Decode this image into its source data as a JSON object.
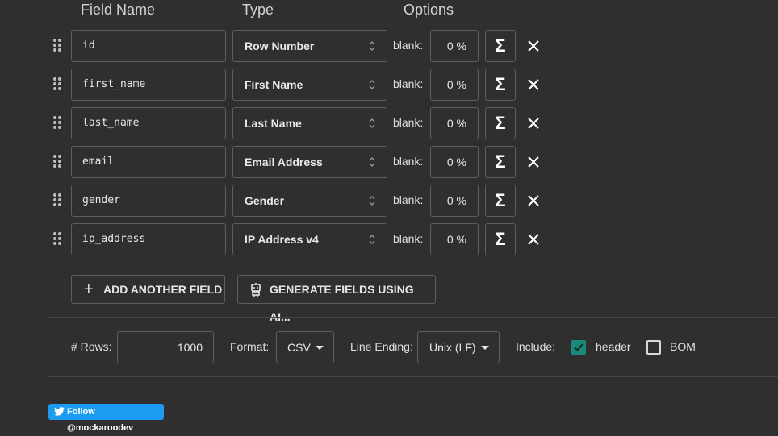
{
  "headers": {
    "field_name": "Field Name",
    "type": "Type",
    "options": "Options"
  },
  "fields": [
    {
      "name": "id",
      "type": "Row Number",
      "blank_label": "blank:",
      "blank_pct": "0 %",
      "sigma": "Σ"
    },
    {
      "name": "first_name",
      "type": "First Name",
      "blank_label": "blank:",
      "blank_pct": "0 %",
      "sigma": "Σ"
    },
    {
      "name": "last_name",
      "type": "Last Name",
      "blank_label": "blank:",
      "blank_pct": "0 %",
      "sigma": "Σ"
    },
    {
      "name": "email",
      "type": "Email Address",
      "blank_label": "blank:",
      "blank_pct": "0 %",
      "sigma": "Σ"
    },
    {
      "name": "gender",
      "type": "Gender",
      "blank_label": "blank:",
      "blank_pct": "0 %",
      "sigma": "Σ"
    },
    {
      "name": "ip_address",
      "type": "IP Address v4",
      "blank_label": "blank:",
      "blank_pct": "0 %",
      "sigma": "Σ"
    }
  ],
  "buttons": {
    "add_field": "ADD ANOTHER FIELD",
    "generate_ai": "GENERATE FIELDS USING AI..."
  },
  "settings": {
    "rows_label": "# Rows:",
    "rows_value": "1000",
    "format_label": "Format:",
    "format_value": "CSV",
    "line_ending_label": "Line Ending:",
    "line_ending_value": "Unix (LF)",
    "include_label": "Include:",
    "header_label": "header",
    "header_checked": true,
    "bom_label": "BOM",
    "bom_checked": false
  },
  "twitter": {
    "label": "Follow @mockaroodev"
  },
  "colors": {
    "background": "#2f2f2f",
    "border": "#5e5e5e",
    "checkbox_accent": "#1a8a7a",
    "twitter_blue": "#1d9bf0"
  }
}
